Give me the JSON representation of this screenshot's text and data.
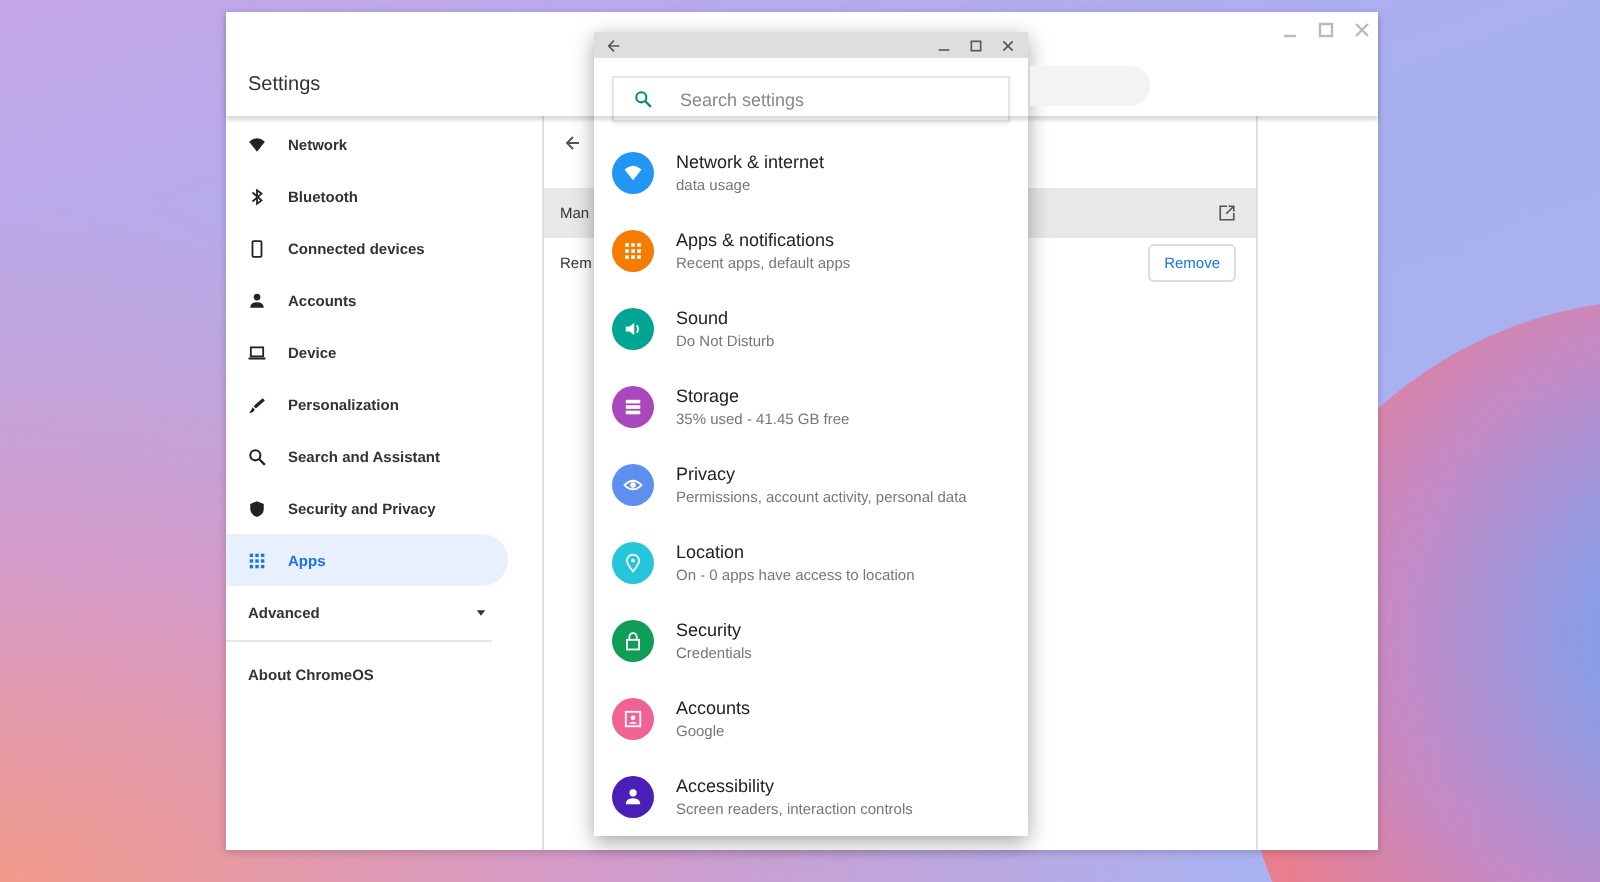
{
  "settings_window": {
    "title": "Settings",
    "sidebar": {
      "items": [
        {
          "label": "Network",
          "selected": false
        },
        {
          "label": "Bluetooth",
          "selected": false
        },
        {
          "label": "Connected devices",
          "selected": false
        },
        {
          "label": "Accounts",
          "selected": false
        },
        {
          "label": "Device",
          "selected": false
        },
        {
          "label": "Personalization",
          "selected": false
        },
        {
          "label": "Search and Assistant",
          "selected": false
        },
        {
          "label": "Security and Privacy",
          "selected": false
        },
        {
          "label": "Apps",
          "selected": true
        }
      ],
      "advanced": {
        "label": "Advanced",
        "expanded": false
      },
      "about": "About ChromeOS"
    },
    "content": {
      "rows": [
        {
          "kind": "link",
          "label": "Man"
        },
        {
          "kind": "action",
          "label": "Rem",
          "button": "Remove"
        }
      ]
    }
  },
  "android_window": {
    "search": {
      "placeholder": "Search settings"
    },
    "items": [
      {
        "title": "Network & internet",
        "subtitle": "data usage",
        "color": "#2196f3"
      },
      {
        "title": "Apps & notifications",
        "subtitle": "Recent apps, default apps",
        "color": "#f57c00"
      },
      {
        "title": "Sound",
        "subtitle": "Do Not Disturb",
        "color": "#00a593"
      },
      {
        "title": "Storage",
        "subtitle": "35% used - 41.45 GB free",
        "color": "#ab47bc"
      },
      {
        "title": "Privacy",
        "subtitle": "Permissions, account activity, personal data",
        "color": "#5e8ff0"
      },
      {
        "title": "Location",
        "subtitle": "On - 0 apps have access to location",
        "color": "#26c6da"
      },
      {
        "title": "Security",
        "subtitle": "Credentials",
        "color": "#0f9d58"
      },
      {
        "title": "Accounts",
        "subtitle": "Google",
        "color": "#f06292"
      },
      {
        "title": "Accessibility",
        "subtitle": "Screen readers, interaction controls",
        "color": "#4a1fb8"
      }
    ]
  }
}
